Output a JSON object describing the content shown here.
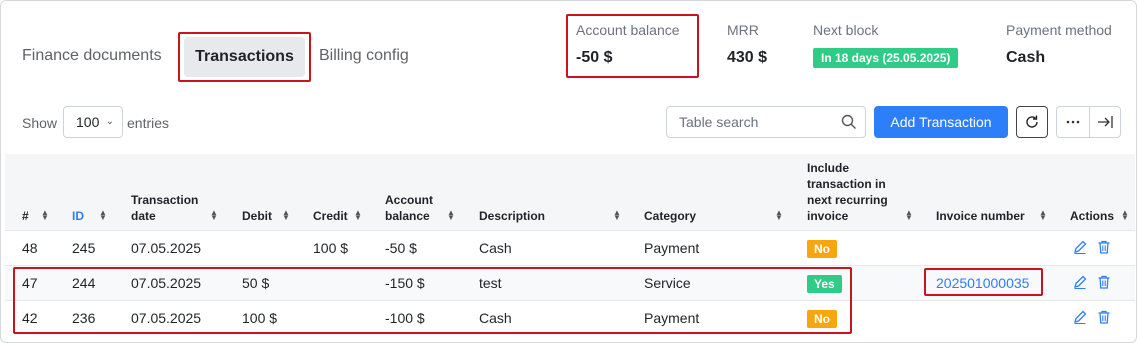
{
  "tabs": {
    "finance_documents": "Finance documents",
    "transactions": "Transactions",
    "billing_config": "Billing config"
  },
  "summary": {
    "account_balance_label": "Account balance",
    "account_balance_value": "-50 $",
    "mrr_label": "MRR",
    "mrr_value": "430 $",
    "next_block_label": "Next block",
    "next_block_badge": "In 18 days (25.05.2025)",
    "payment_method_label": "Payment method",
    "payment_method_value": "Cash"
  },
  "controls": {
    "show_label": "Show",
    "page_size": "100",
    "entries_label": "entries",
    "search_placeholder": "Table search",
    "add_button": "Add Transaction"
  },
  "columns": {
    "num": "#",
    "id": "ID",
    "date": "Transaction date",
    "debit": "Debit",
    "credit": "Credit",
    "balance": "Account balance",
    "description": "Description",
    "category": "Category",
    "include": "Include transaction in next recurring invoice",
    "invoice": "Invoice number",
    "actions": "Actions"
  },
  "rows": [
    {
      "num": "48",
      "id": "245",
      "date": "07.05.2025",
      "debit": "",
      "credit": "100 $",
      "balance": "-50 $",
      "description": "Cash",
      "category": "Payment",
      "include": "No",
      "invoice": ""
    },
    {
      "num": "47",
      "id": "244",
      "date": "07.05.2025",
      "debit": "50 $",
      "credit": "",
      "balance": "-150 $",
      "description": "test",
      "category": "Service",
      "include": "Yes",
      "invoice": "202501000035"
    },
    {
      "num": "42",
      "id": "236",
      "date": "07.05.2025",
      "debit": "100 $",
      "credit": "",
      "balance": "-100 $",
      "description": "Cash",
      "category": "Payment",
      "include": "No",
      "invoice": ""
    }
  ],
  "colors": {
    "accent": "#2d7ff9",
    "yes_badge": "#2ecc87",
    "no_badge": "#f7a60f",
    "highlight": "#c8141e"
  }
}
